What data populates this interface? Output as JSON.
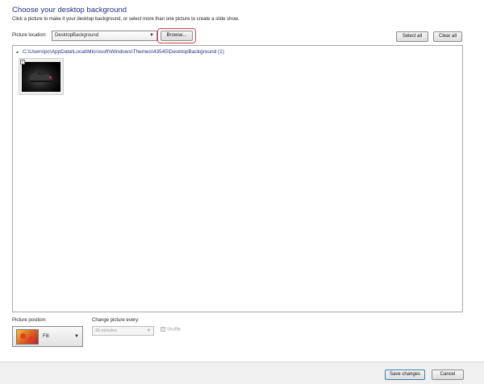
{
  "header": {
    "title": "Choose your desktop background",
    "subtitle": "Click a picture to make it your desktop background, or select more than one picture to create a slide show."
  },
  "location": {
    "label": "Picture location:",
    "selected": "DesktopBackground",
    "browse_label": "Browse...",
    "select_all_label": "Select all",
    "clear_all_label": "Clear all"
  },
  "gallery": {
    "group_path": "C:\\Users\\pc\\AppData\\Local\\Microsoft\\Windows\\Themes\\43545\\DesktopBackground (1)",
    "expand_glyph": "▲",
    "items": [
      {
        "checked": true,
        "check_glyph": "✓",
        "icon": "dark-car-wallpaper-thumbnail"
      }
    ]
  },
  "position": {
    "label": "Picture position:",
    "selected": "Fill",
    "icon": "flower-fill-preview-icon"
  },
  "slideshow": {
    "label": "Change picture every:",
    "interval": "30 minutes",
    "shuffle_label": "Shuffle",
    "shuffle_checked": true,
    "enabled": false
  },
  "footer": {
    "save_label": "Save changes",
    "cancel_label": "Cancel"
  },
  "colors": {
    "title": "#1e3287",
    "browse_highlight": "#d04050"
  }
}
